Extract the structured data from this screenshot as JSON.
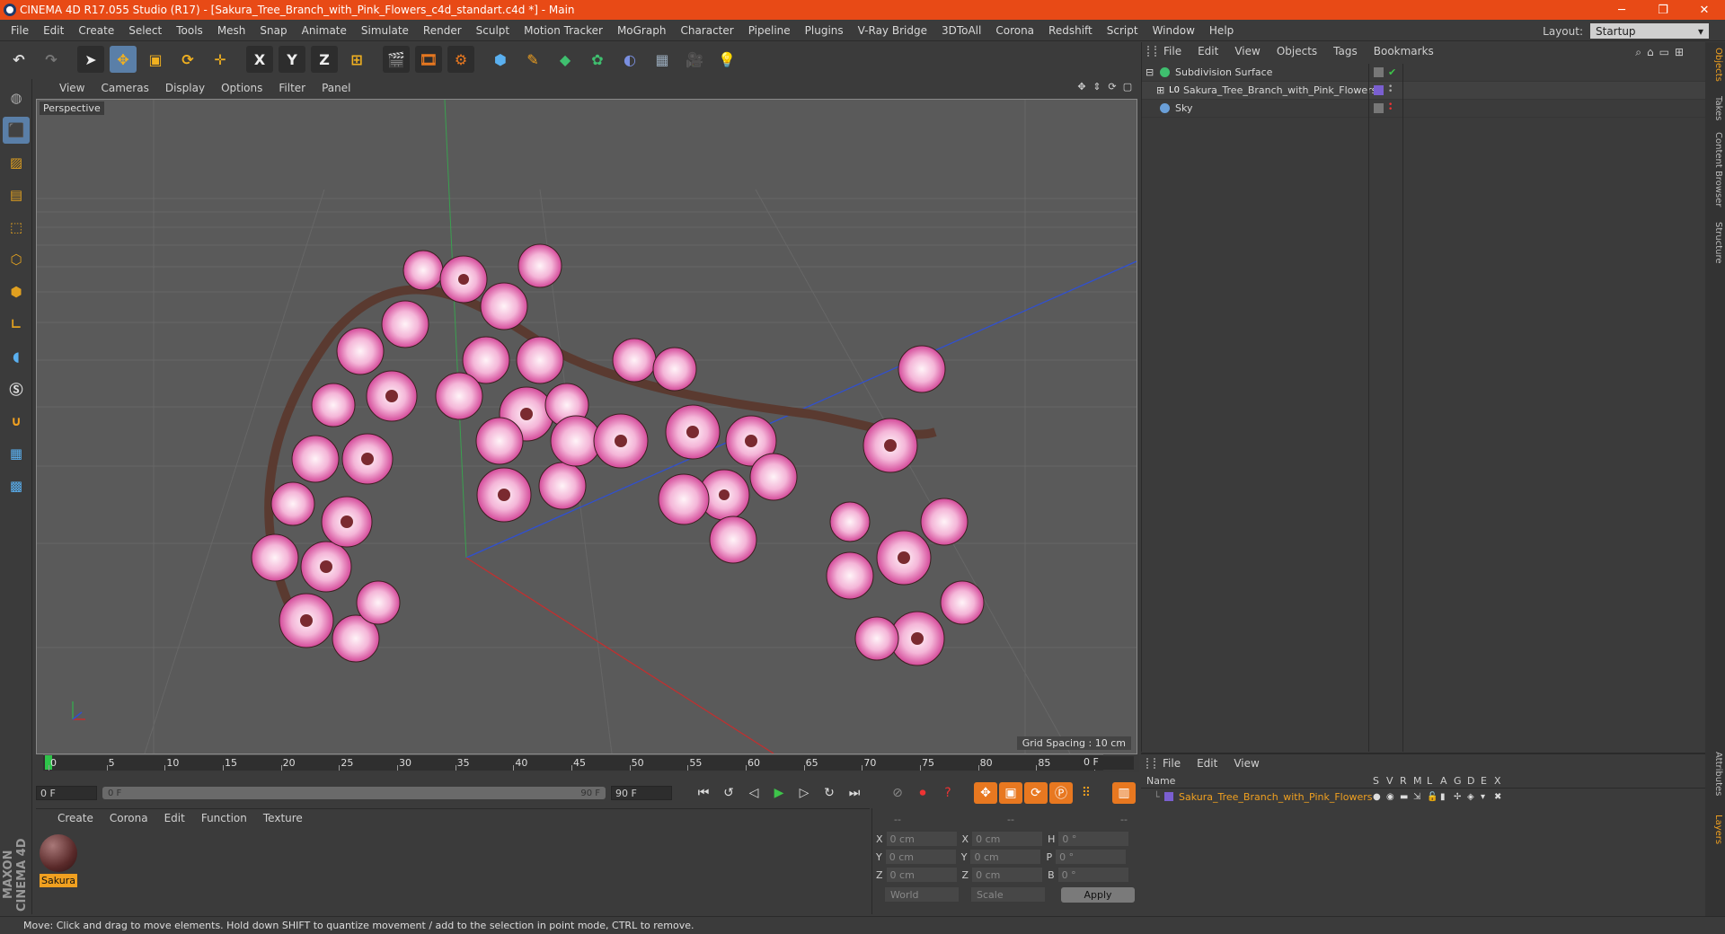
{
  "window": {
    "title": "CINEMA 4D R17.055 Studio (R17) - [Sakura_Tree_Branch_with_Pink_Flowers_c4d_standart.c4d *] - Main",
    "minimize": "─",
    "restore": "❐",
    "close": "✕"
  },
  "menu": [
    "File",
    "Edit",
    "Create",
    "Select",
    "Tools",
    "Mesh",
    "Snap",
    "Animate",
    "Simulate",
    "Render",
    "Sculpt",
    "Motion Tracker",
    "MoGraph",
    "Character",
    "Pipeline",
    "Plugins",
    "V-Ray Bridge",
    "3DToAll",
    "Corona",
    "Redshift",
    "Script",
    "Window",
    "Help"
  ],
  "layout": {
    "label": "Layout:",
    "value": "Startup"
  },
  "toolbar": {
    "x": "X",
    "y": "Y",
    "z": "Z"
  },
  "viewport": {
    "menu": [
      "View",
      "Cameras",
      "Display",
      "Options",
      "Filter",
      "Panel"
    ],
    "label": "Perspective",
    "grid_spacing": "Grid Spacing : 10 cm"
  },
  "objects_panel": {
    "menu": [
      "File",
      "Edit",
      "View",
      "Objects",
      "Tags",
      "Bookmarks"
    ],
    "items": [
      {
        "name": "Subdivision Surface",
        "color": "#3fbf6f"
      },
      {
        "name": "Sakura_Tree_Branch_with_Pink_Flowers",
        "color": "#7a5fd0"
      },
      {
        "name": "Sky",
        "color": "#6a9fd8"
      }
    ],
    "lo_label": "L0"
  },
  "right_tabs": [
    "Objects",
    "Takes",
    "Content Browser",
    "Structure",
    "Attributes",
    "Layers"
  ],
  "timeline": {
    "ticks": [
      "0",
      "5",
      "10",
      "15",
      "20",
      "25",
      "30",
      "35",
      "40",
      "45",
      "50",
      "55",
      "60",
      "65",
      "70",
      "75",
      "80",
      "85",
      "90"
    ],
    "current_frame": "0 F",
    "start_field": "0 F",
    "slider_start": "0 F",
    "slider_end": "90 F",
    "end_field": "90 F"
  },
  "material_panel": {
    "menu": [
      "Create",
      "Corona",
      "Edit",
      "Function",
      "Texture"
    ],
    "material_name": "Sakura"
  },
  "coordinates": {
    "headers": [
      "--",
      "--",
      "--"
    ],
    "rows": [
      {
        "a": "X",
        "av": "0 cm",
        "b": "X",
        "bv": "0 cm",
        "c": "H",
        "cv": "0 °"
      },
      {
        "a": "Y",
        "av": "0 cm",
        "b": "Y",
        "bv": "0 cm",
        "c": "P",
        "cv": "0 °"
      },
      {
        "a": "Z",
        "av": "0 cm",
        "b": "Z",
        "bv": "0 cm",
        "c": "B",
        "cv": "0 °"
      }
    ],
    "world": "World",
    "scale": "Scale",
    "apply": "Apply"
  },
  "layers_panel": {
    "menu": [
      "File",
      "Edit",
      "View"
    ],
    "name_header": "Name",
    "flags": [
      "S",
      "V",
      "R",
      "M",
      "L",
      "A",
      "G",
      "D",
      "E",
      "X"
    ],
    "layer_name": "Sakura_Tree_Branch_with_Pink_Flowers"
  },
  "brand": "MAXON CINEMA 4D",
  "status": "Move: Click and drag to move elements. Hold down SHIFT to quantize movement / add to the selection in point mode, CTRL to remove."
}
